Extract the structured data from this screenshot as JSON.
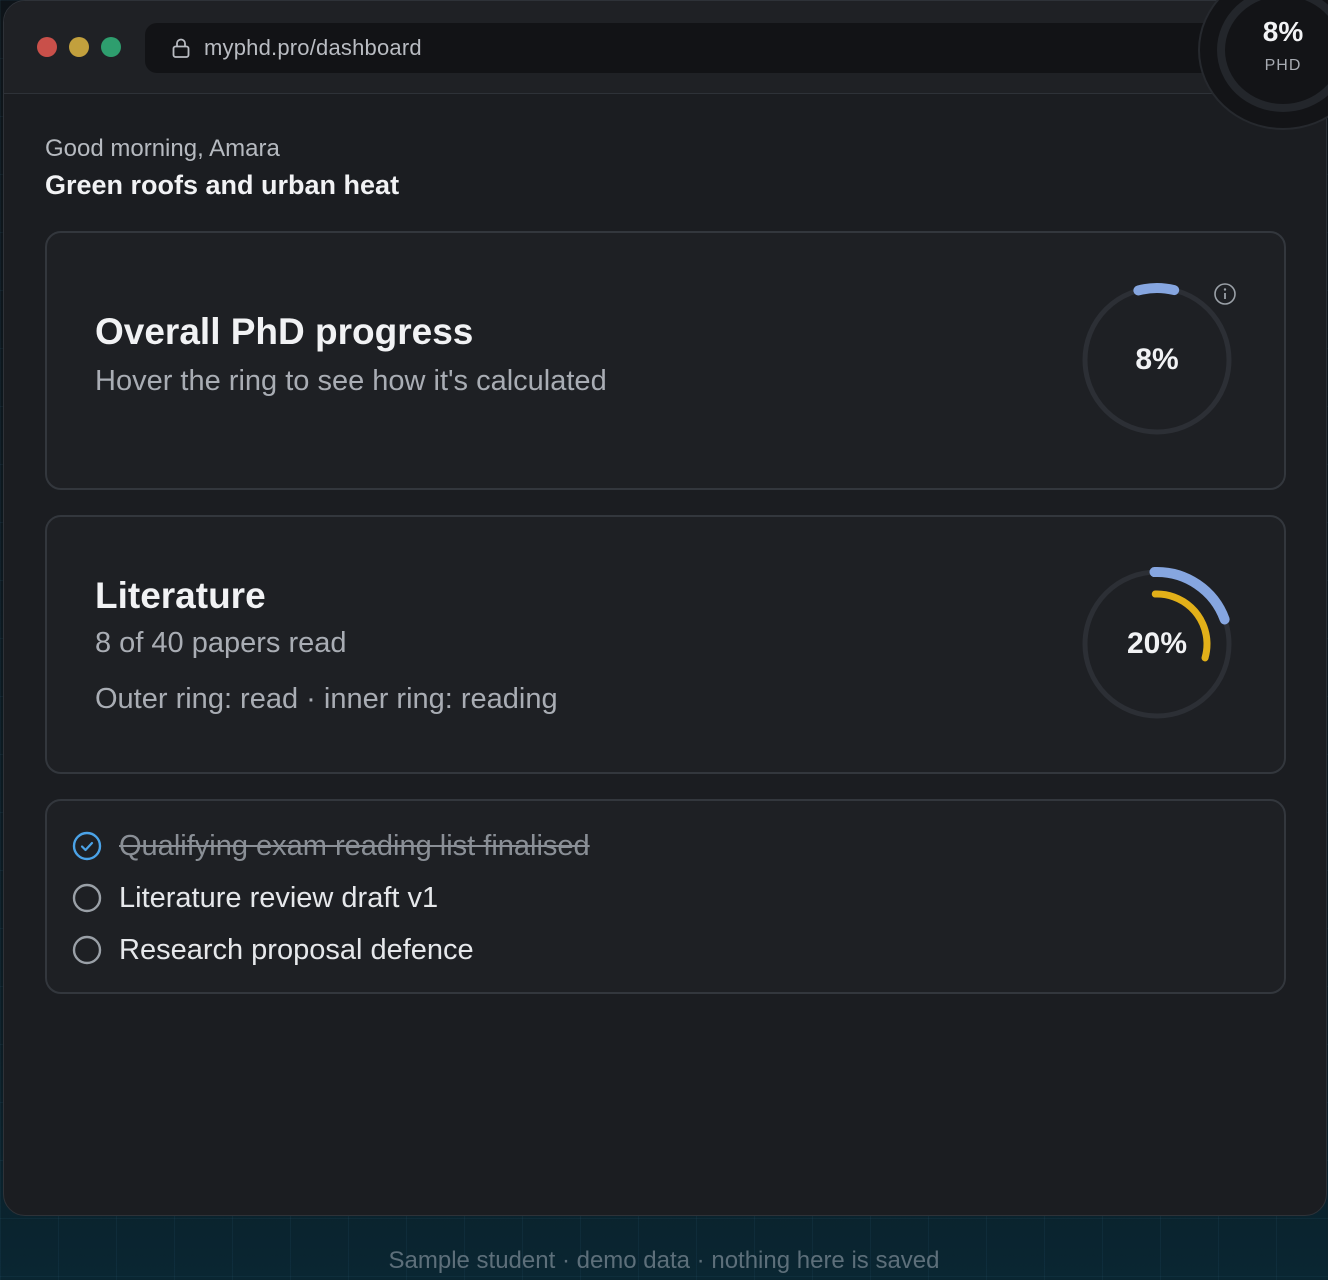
{
  "browser": {
    "url": "myphd.pro/dashboard",
    "lock_icon": "lock-icon"
  },
  "header_badge": {
    "value": "8%",
    "label": "PHD",
    "progress": 0.08
  },
  "greeting": "Good morning, Amara",
  "project_title": "Green roofs and urban heat",
  "progress_card": {
    "title": "Overall PhD progress",
    "subtitle": "Hover the ring to see how it's calculated",
    "ring_value": "8%",
    "ring_fraction": 0.08,
    "info_icon": "info-icon",
    "ring_color": "#86a6e0"
  },
  "literature_card": {
    "title": "Literature",
    "subtitle": "8 of 40 papers read",
    "note": "Outer ring: read · inner ring: reading",
    "ring_value": "20%",
    "outer_fraction": 0.2,
    "inner_fraction": 0.3,
    "outer_color": "#86a6e0",
    "inner_color": "#e2b019"
  },
  "milestones": [
    {
      "label": "Qualifying exam reading list finalised",
      "done": true
    },
    {
      "label": "Literature review draft v1",
      "done": false
    },
    {
      "label": "Research proposal defence",
      "done": false
    }
  ],
  "footer": "Sample student · demo data · nothing here is saved",
  "colors": {
    "accent_blue": "#86a6e0",
    "accent_yellow": "#e2b019",
    "check_blue": "#4ba3e8",
    "background": "#1b1d21"
  }
}
